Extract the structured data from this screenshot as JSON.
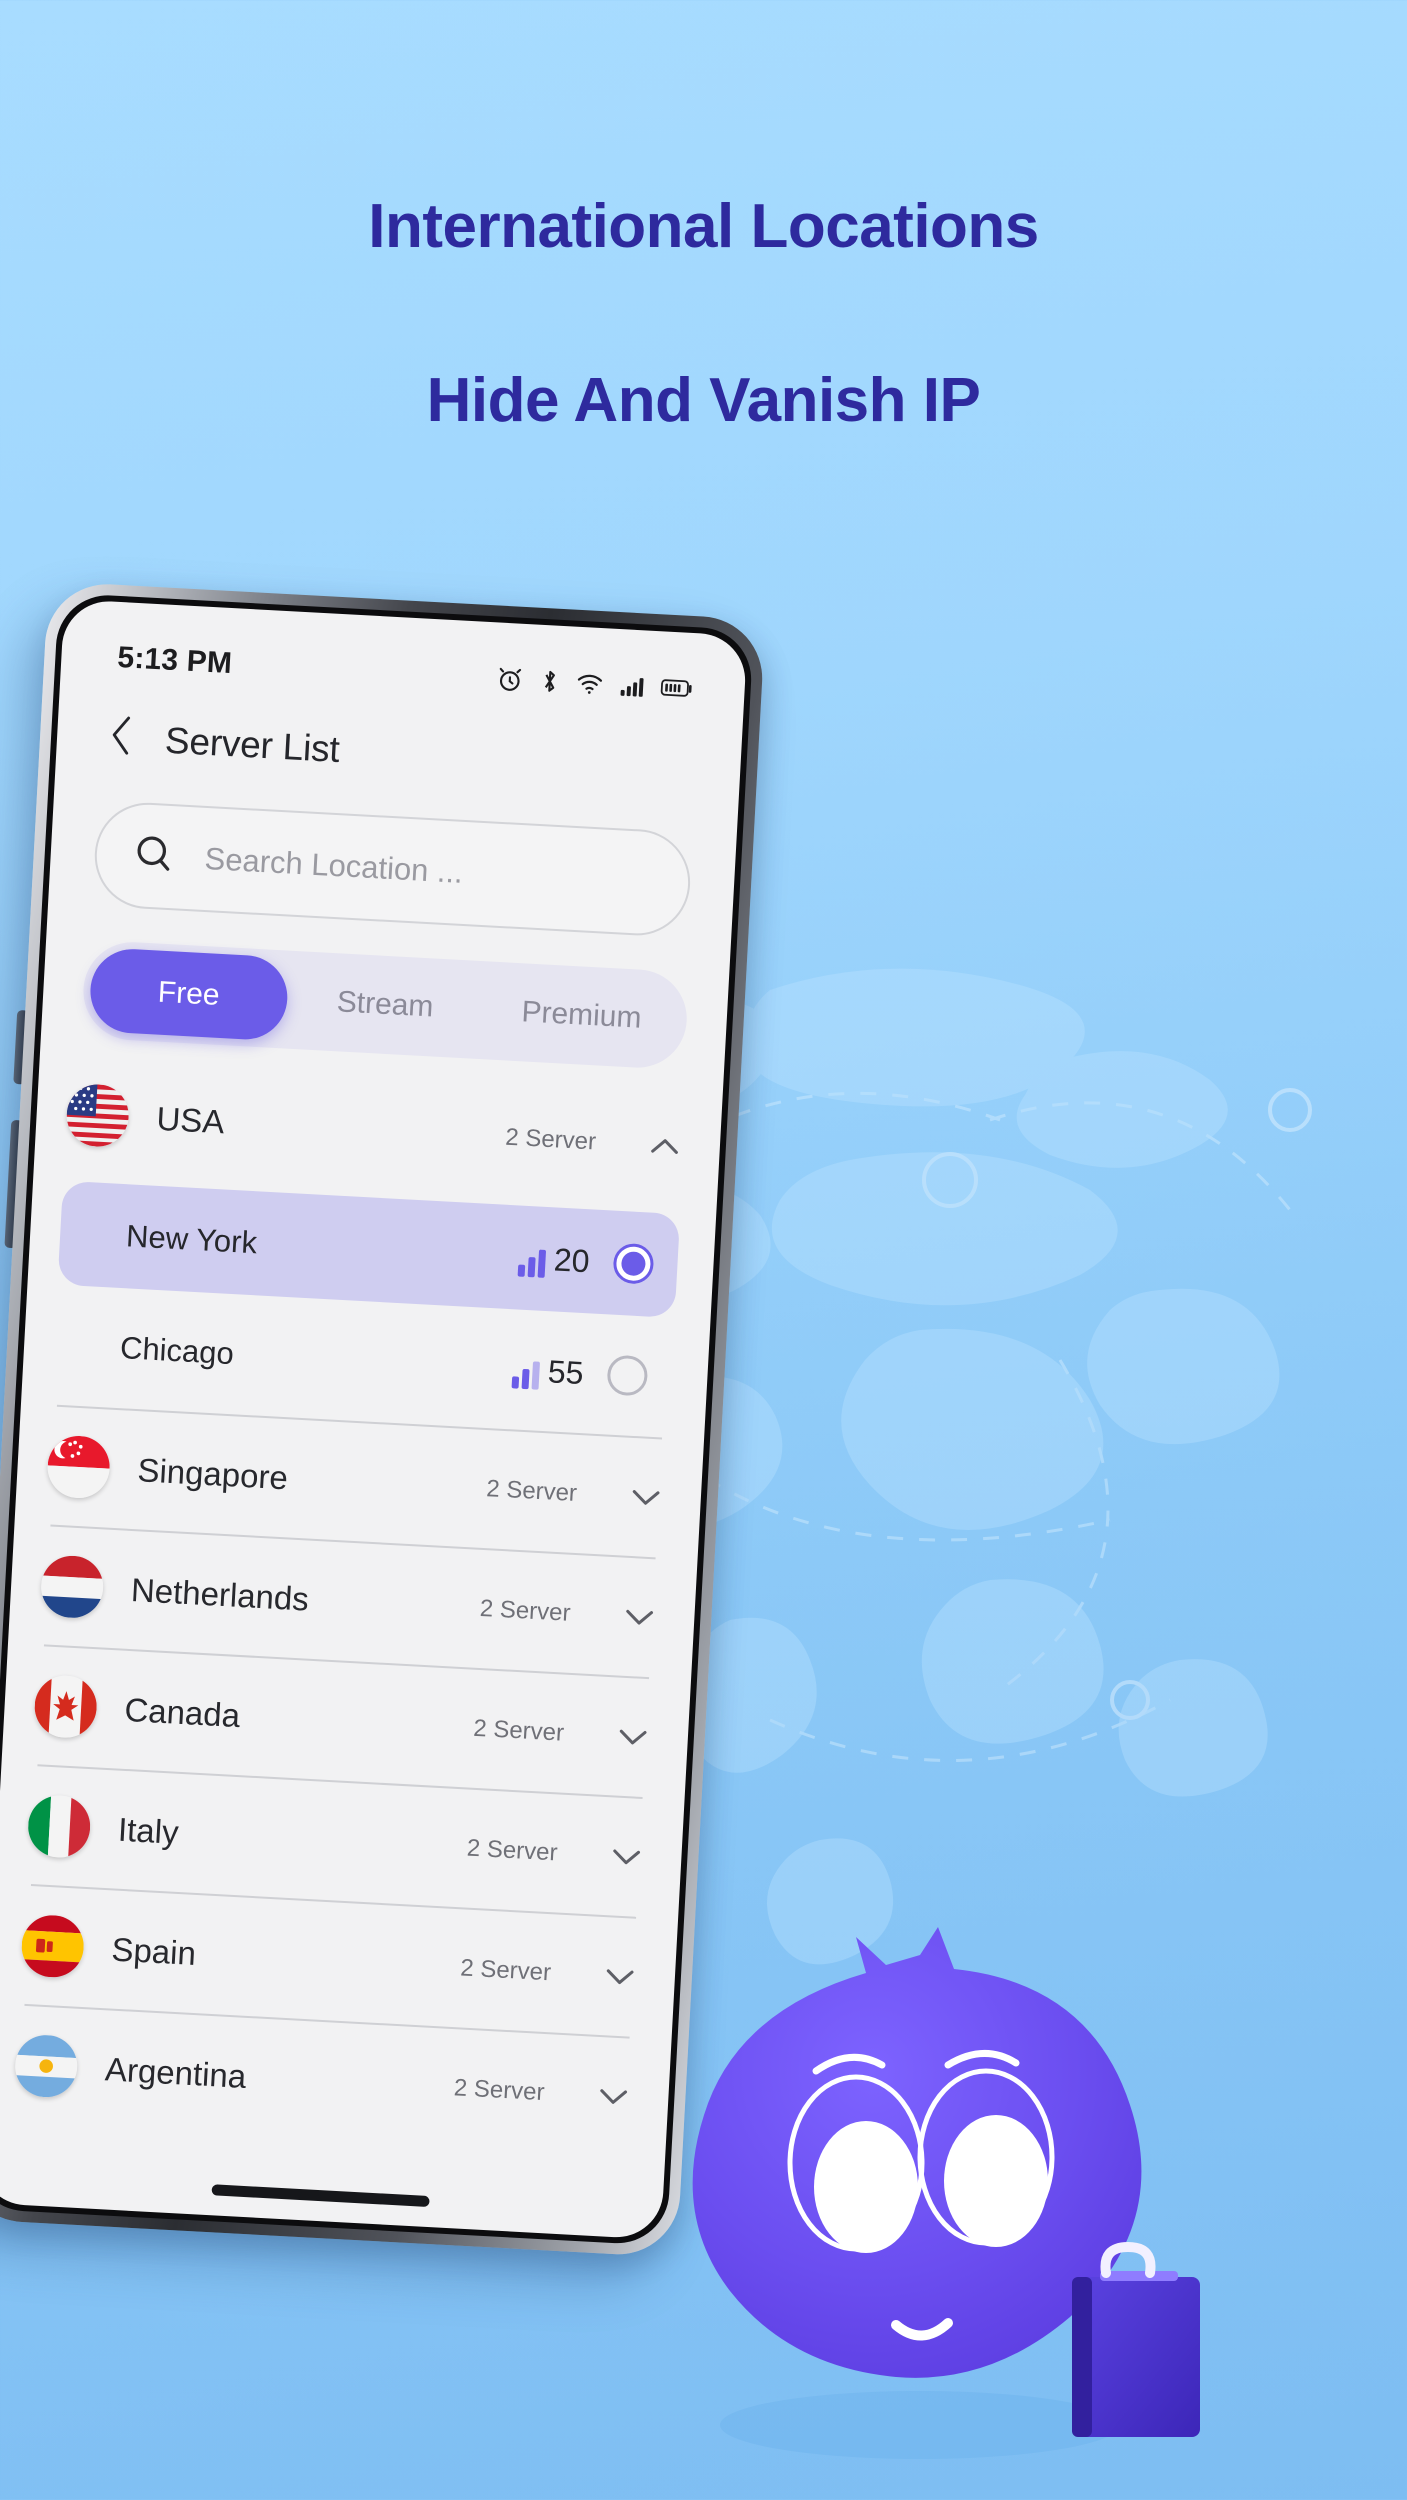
{
  "promo": {
    "heading_line_1": "International Locations",
    "heading_line_2": "Hide And Vanish IP",
    "heading_color": "#2e2a9e",
    "background_top_color": "#a8dcff",
    "background_bottom_color": "#7dbdf2",
    "accent_color": "#6b5ce8"
  },
  "phone": {
    "status_bar": {
      "time": "5:13 PM",
      "icons": [
        "alarm-clock-icon",
        "bluetooth-icon",
        "wifi-icon",
        "cellular-signal-icon",
        "battery-icon"
      ]
    },
    "header": {
      "back_icon": "chevron-left-icon",
      "title": "Server List"
    },
    "search": {
      "icon": "search-icon",
      "placeholder": "Search Location ...",
      "value": ""
    },
    "tabs": [
      {
        "label": "Free",
        "active": true
      },
      {
        "label": "Stream",
        "active": false
      },
      {
        "label": "Premium",
        "active": false
      }
    ],
    "server_list": [
      {
        "country": "USA",
        "flag": "flag-usa",
        "server_count": "2 Server",
        "expanded": true,
        "chevron": "chevron-up-icon",
        "cities": [
          {
            "name": "New York",
            "ping": "20",
            "selected": true,
            "signal": "signal-strong"
          },
          {
            "name": "Chicago",
            "ping": "55",
            "selected": false,
            "signal": "signal-medium"
          }
        ]
      },
      {
        "country": "Singapore",
        "flag": "flag-singapore",
        "server_count": "2 Server",
        "expanded": false,
        "chevron": "chevron-down-icon",
        "cities": []
      },
      {
        "country": "Netherlands",
        "flag": "flag-netherlands",
        "server_count": "2 Server",
        "expanded": false,
        "chevron": "chevron-down-icon",
        "cities": []
      },
      {
        "country": "Canada",
        "flag": "flag-canada",
        "server_count": "2 Server",
        "expanded": false,
        "chevron": "chevron-down-icon",
        "cities": []
      },
      {
        "country": "Italy",
        "flag": "flag-italy",
        "server_count": "2 Server",
        "expanded": false,
        "chevron": "chevron-down-icon",
        "cities": []
      },
      {
        "country": "Spain",
        "flag": "flag-spain",
        "server_count": "2 Server",
        "expanded": false,
        "chevron": "chevron-down-icon",
        "cities": []
      },
      {
        "country": "Argentina",
        "flag": "flag-argentina",
        "server_count": "2 Server",
        "expanded": false,
        "chevron": "chevron-down-icon",
        "cities": []
      }
    ],
    "home_indicator": true
  },
  "mascot": {
    "name": "vpn-mascot-character",
    "body_color": "#6b4ef0",
    "suitcase_color": "#4a32cf",
    "has_suitcase": true
  }
}
